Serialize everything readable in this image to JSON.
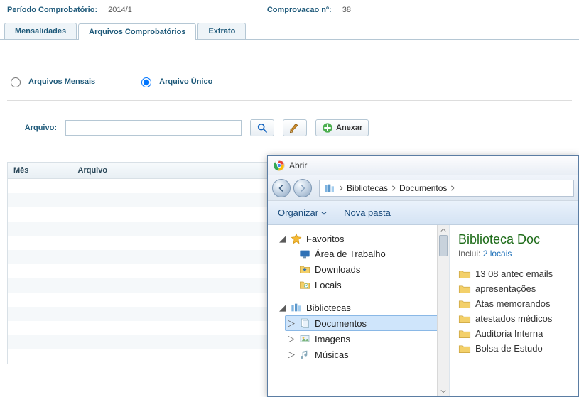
{
  "header": {
    "periodo_label": "Período Comprobatório:",
    "periodo_value": "2014/1",
    "comprov_label": "Comprovacao nº:",
    "comprov_value": "38"
  },
  "tabs": {
    "mensalidades": "Mensalidades",
    "arquivos": "Arquivos Comprobatórios",
    "extrato": "Extrato"
  },
  "radios": {
    "mensais": "Arquivos Mensais",
    "unico": "Arquivo Único"
  },
  "file": {
    "label": "Arquivo:",
    "value": "",
    "anexar": "Anexar"
  },
  "table": {
    "col_mes": "Mês",
    "col_arquivo": "Arquivo"
  },
  "dialog": {
    "title": "Abrir",
    "crumb1": "Bibliotecas",
    "crumb2": "Documentos",
    "organizar": "Organizar",
    "nova_pasta": "Nova pasta",
    "tree": {
      "favoritos": "Favoritos",
      "area": "Área de Trabalho",
      "downloads": "Downloads",
      "locais": "Locais",
      "bibliotecas": "Bibliotecas",
      "documentos": "Documentos",
      "imagens": "Imagens",
      "musicas": "Músicas"
    },
    "content": {
      "title": "Biblioteca Doc",
      "inclui_label": "Inclui:",
      "inclui_link": "2 locais",
      "folders": [
        "13 08 antec emails",
        "apresentações",
        "Atas memorandos",
        "atestados médicos",
        "Auditoria Interna",
        "Bolsa de Estudo"
      ]
    }
  }
}
